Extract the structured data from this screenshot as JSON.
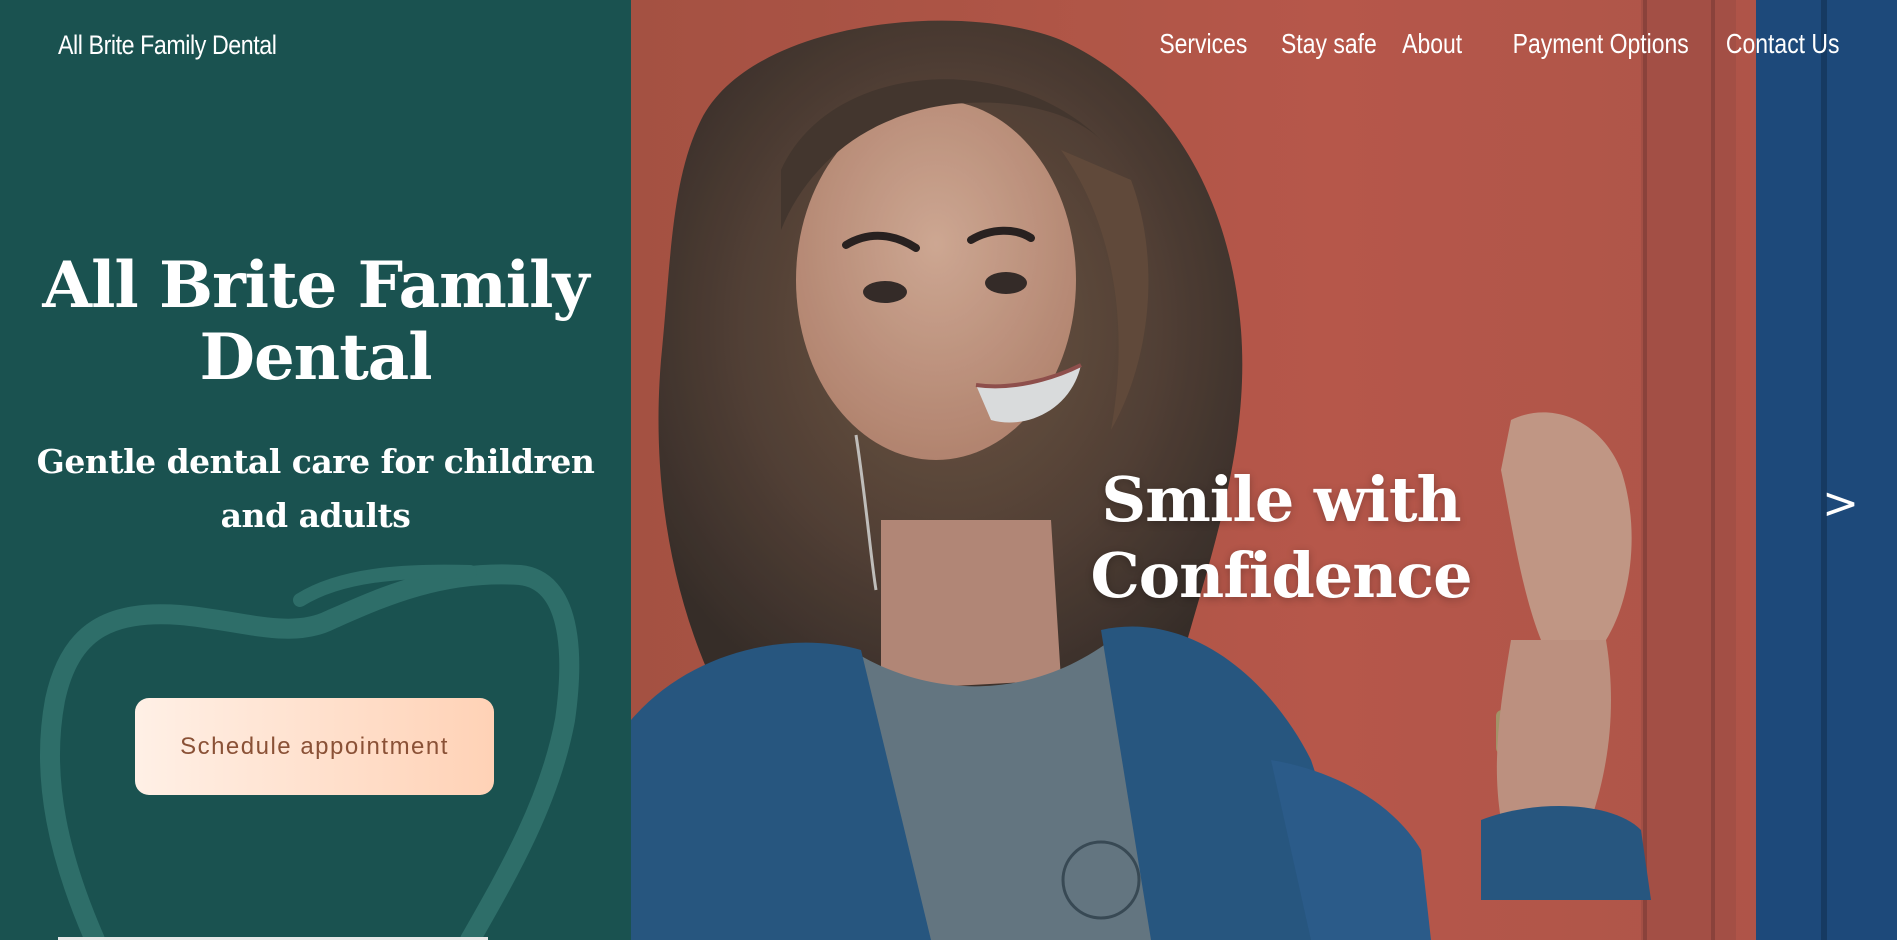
{
  "brand": {
    "name": "All Brite Family Dental"
  },
  "nav": {
    "items": [
      {
        "label": "Services"
      },
      {
        "label": "Stay safe"
      },
      {
        "label": "About"
      },
      {
        "label": "Payment Options"
      },
      {
        "label": "Contact Us"
      }
    ]
  },
  "hero": {
    "title": "All Brite Family Dental",
    "subtitle": "Gentle dental care for children and adults",
    "cta_label": "Schedule appointment"
  },
  "slider": {
    "caption": "Smile with Confidence",
    "next_label": ">"
  },
  "icons": {
    "tooth": "tooth-outline-icon",
    "next": "chevron-right-icon"
  },
  "colors": {
    "panel_bg": "#1a5250",
    "cta_gradient_start": "#fff0e6",
    "cta_gradient_end": "#ffd2b6",
    "cta_text": "#8a5136",
    "text": "#ffffff"
  }
}
